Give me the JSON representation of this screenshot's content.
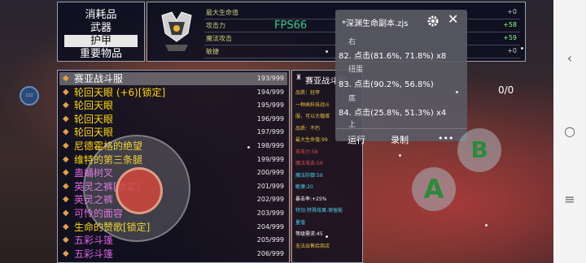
{
  "categories": [
    "消耗品",
    "武器",
    "护甲",
    "重要物品"
  ],
  "selected_category": 2,
  "stats": [
    {
      "label": "最大生命值",
      "value": "+0"
    },
    {
      "label": "攻击力",
      "value": "+58"
    },
    {
      "label": "魔法攻击",
      "value": "+59"
    },
    {
      "label": "敏捷",
      "value": "+0"
    }
  ],
  "fps": "FPS66",
  "items": [
    {
      "name": "赛亚战斗服",
      "count": "193/999",
      "color": "#ffffff",
      "icon": "armor-icon"
    },
    {
      "name": "轮回天眼 (+6)[锁定]",
      "count": "194/999",
      "color": "#ffd800",
      "icon": "eye-icon"
    },
    {
      "name": "轮回天眼",
      "count": "195/999",
      "color": "#ffd800",
      "icon": "eye-icon"
    },
    {
      "name": "轮回天眼",
      "count": "196/999",
      "color": "#ffd800",
      "icon": "eye-icon"
    },
    {
      "name": "轮回天眼",
      "count": "197/999",
      "color": "#ffd800",
      "icon": "eye-icon"
    },
    {
      "name": "尼德霍格的绝望",
      "count": "198/999",
      "color": "#ffd800",
      "icon": "claw-icon"
    },
    {
      "name": "维特的第三条腿",
      "count": "199/999",
      "color": "#ffd800",
      "icon": "leg-icon"
    },
    {
      "name": "蛊蛹树叉",
      "count": "200/999",
      "color": "#e060e0",
      "icon": "branch-icon"
    },
    {
      "name": "英灵之裤[锁定]",
      "count": "201/999",
      "color": "#e060e0",
      "icon": "pants-icon"
    },
    {
      "name": "英灵之裤",
      "count": "202/999",
      "color": "#e060e0",
      "icon": "pants-icon"
    },
    {
      "name": "可怜的面容",
      "count": "203/999",
      "color": "#e060e0",
      "icon": "face-icon"
    },
    {
      "name": "生命的赞歌[锁定]",
      "count": "204/999",
      "color": "#ffd800",
      "icon": "note-icon"
    },
    {
      "name": "五彩斗篷",
      "count": "205/999",
      "color": "#e060e0",
      "icon": "cloak-icon"
    },
    {
      "name": "五彩斗篷",
      "count": "206/999",
      "color": "#e060e0",
      "icon": "cloak-icon"
    }
  ],
  "detail": {
    "title": "赛亚战斗服",
    "lines": [
      {
        "text": "品质：轻甲",
        "color": "#e6c040"
      },
      {
        "text": "一种高科技战斗",
        "color": "#e6c040"
      },
      {
        "text": "服，可以大幅增",
        "color": "#e6c040"
      },
      {
        "text": "品质：不朽",
        "color": "#e6c040"
      },
      {
        "text": "最大生命值:99",
        "color": "#e6c040"
      },
      {
        "text": "攻击力:58",
        "color": "#e05050"
      },
      {
        "text": "魔法攻击:59",
        "color": "#e05050"
      },
      {
        "text": "魔法防御:59",
        "color": "#50d0f0"
      },
      {
        "text": "敏捷:20",
        "color": "#50d0f0"
      },
      {
        "text": "暴击率:+25%",
        "color": "#ffffff"
      },
      {
        "text": "特効:特殊效果:保留能",
        "color": "#50d0f0"
      },
      {
        "text": "量值",
        "color": "#50d0f0"
      },
      {
        "text": "等级需求:45",
        "color": "#ffffff"
      },
      {
        "text": "无法出售给商店",
        "color": "#e6c040"
      }
    ]
  },
  "script_panel": {
    "title": "*深渊生命副本.zjs",
    "lines": [
      {
        "main": "右",
        "sub": true
      },
      {
        "main": "82. 点击(81.6%, 71.8%) x8",
        "sub": false
      },
      {
        "main": "扭蛋",
        "sub": true
      },
      {
        "main": "83. 点击(90.2%, 56.8%)",
        "sub": false
      },
      {
        "main": "底",
        "sub": true
      },
      {
        "main": "84. 点击(25.8%, 51.3%) x4",
        "sub": false
      },
      {
        "main": "上",
        "sub": true
      }
    ],
    "controls": [
      "运行",
      "录制",
      "•••"
    ]
  },
  "ratio": "0/0",
  "buttons": {
    "a": "A",
    "b": "B"
  },
  "side_badge": "zzz"
}
